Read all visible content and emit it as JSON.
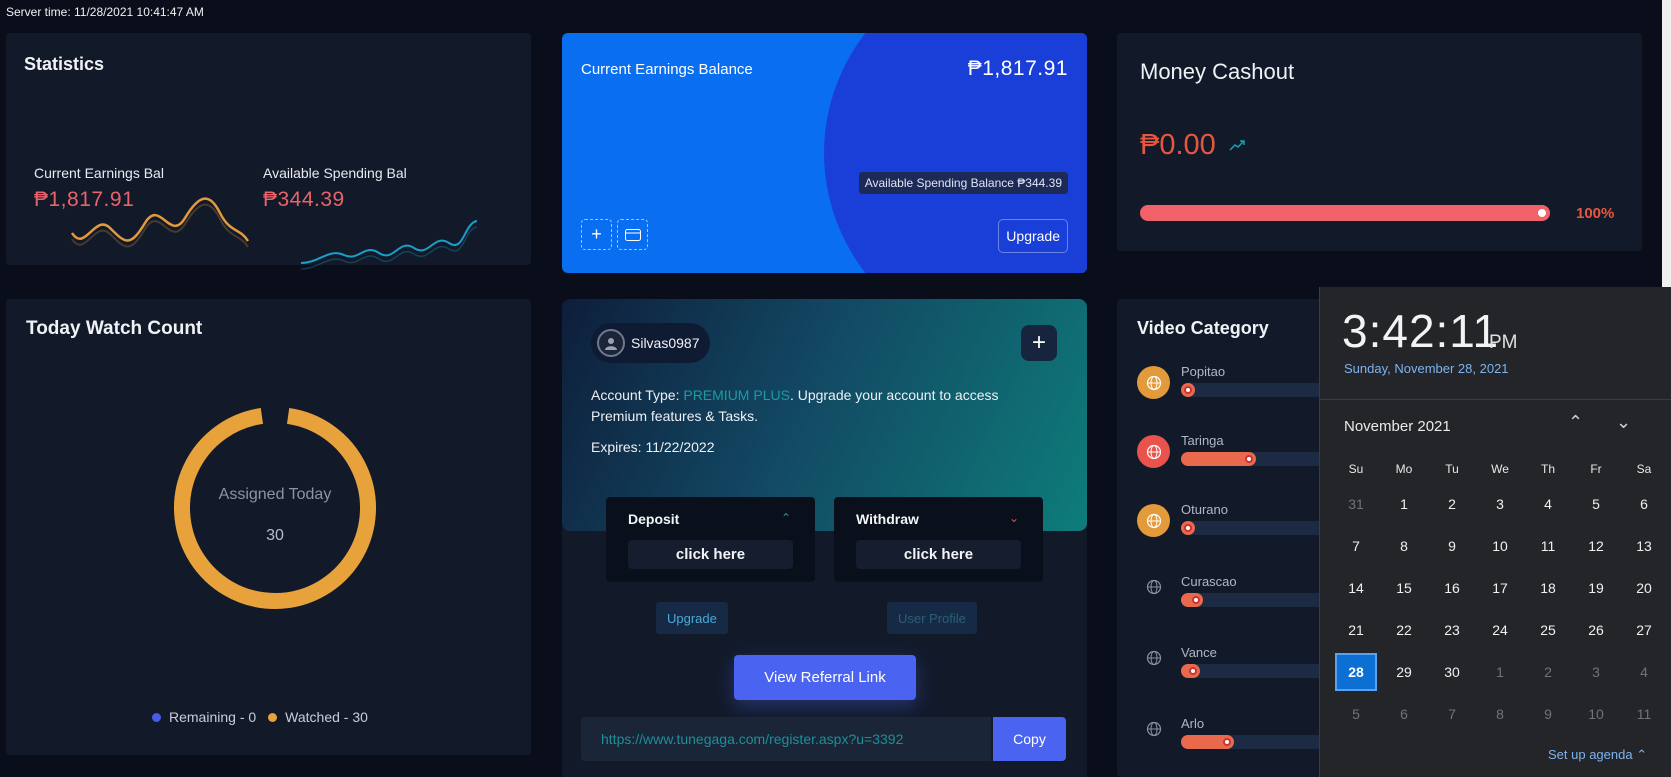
{
  "server_time": "Server time: 11/28/2021 10:41:47 AM",
  "statistics": {
    "title": "Statistics",
    "earnings_label": "Current Earnings Bal",
    "earnings_value": "₱1,817.91",
    "spending_label": "Available Spending Bal",
    "spending_value": "₱344.39",
    "colors": {
      "earnings_line": "#e39a3a",
      "spending_line": "#1aa0c8"
    }
  },
  "earnings_card": {
    "title": "Current Earnings Balance",
    "value": "₱1,817.91",
    "spending_badge": "Available Spending Balance ₱344.39",
    "upgrade_label": "Upgrade",
    "plus_icon": "plus-icon",
    "card_icon": "credit-card-icon"
  },
  "cashout": {
    "title": "Money Cashout",
    "value": "₱0.00",
    "progress_percent": 100,
    "progress_label": "100%"
  },
  "watch_count": {
    "title": "Today Watch Count",
    "center_label": "Assigned Today",
    "center_value": "30",
    "remaining": 0,
    "watched": 30,
    "legend_remaining": "Remaining - 0",
    "legend_watched": "Watched - 30",
    "colors": {
      "remaining": "#4a5be8",
      "watched": "#e8a23c"
    }
  },
  "account": {
    "username": "Silvas0987",
    "type_prefix": "Account Type: ",
    "type_value": "PREMIUM PLUS",
    "type_suffix": ". Upgrade your account to access Premium features & Tasks.",
    "expires": "Expires: 11/22/2022",
    "deposit_title": "Deposit",
    "deposit_button": "click here",
    "withdraw_title": "Withdraw",
    "withdraw_button": "click here",
    "upgrade_link": "Upgrade",
    "profile_link": "User Profile",
    "referral_button": "View Referral Link",
    "referral_url": "https://www.tunegaga.com/register.aspx?u=3392",
    "copy_button": "Copy"
  },
  "video_category": {
    "title": "Video Category",
    "items": [
      {
        "name": "Popitao",
        "progress": 0.08,
        "icon_bg": "#e39a3a"
      },
      {
        "name": "Taringa",
        "progress": 0.47,
        "icon_bg": "#e8534c"
      },
      {
        "name": "Oturano",
        "progress": 0.04,
        "icon_bg": "#e39a3a"
      },
      {
        "name": "Curascao",
        "progress": 0.14,
        "icon_bg": ""
      },
      {
        "name": "Vance",
        "progress": 0.12,
        "icon_bg": ""
      },
      {
        "name": "Arlo",
        "progress": 0.33,
        "icon_bg": ""
      }
    ]
  },
  "calendar": {
    "time": "3:42:11",
    "ampm": "PM",
    "date": "Sunday, November 28, 2021",
    "month": "November 2021",
    "weekdays": [
      "Su",
      "Mo",
      "Tu",
      "We",
      "Th",
      "Fr",
      "Sa"
    ],
    "days": [
      "31",
      "1",
      "2",
      "3",
      "4",
      "5",
      "6",
      "7",
      "8",
      "9",
      "10",
      "11",
      "12",
      "13",
      "14",
      "15",
      "16",
      "17",
      "18",
      "19",
      "20",
      "21",
      "22",
      "23",
      "24",
      "25",
      "26",
      "27",
      "28",
      "29",
      "30",
      "1",
      "2",
      "3",
      "4",
      "5",
      "6",
      "7",
      "8",
      "9",
      "10",
      "11"
    ],
    "today": "28",
    "agenda": "Set up agenda"
  }
}
